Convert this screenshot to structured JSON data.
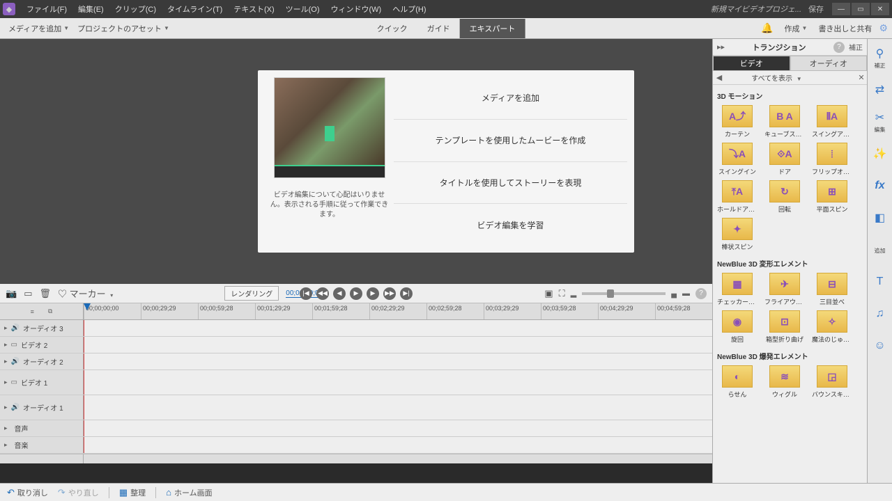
{
  "titlebar": {
    "menus": [
      "ファイル(F)",
      "編集(E)",
      "クリップ(C)",
      "タイムライン(T)",
      "テキスト(X)",
      "ツール(O)",
      "ウィンドウ(W)",
      "ヘルプ(H)"
    ],
    "project": "新規マイビデオプロジェ...",
    "save": "保存"
  },
  "toolbar": {
    "add_media": "メディアを追加",
    "project_assets": "プロジェクトのアセット",
    "modes": [
      "クイック",
      "ガイド",
      "エキスパート"
    ],
    "active_mode": 2,
    "create": "作成",
    "export": "書き出しと共有"
  },
  "welcome": {
    "desc": "ビデオ編集について心配はいりません。表示される手順に従って作業できます。",
    "items": [
      "メディアを追加",
      "テンプレートを使用したムービーを作成",
      "タイトルを使用してストーリーを表現",
      "ビデオ編集を学習"
    ]
  },
  "transitions": {
    "title": "トランジション",
    "tab_video": "ビデオ",
    "tab_audio": "オーディオ",
    "filter": "すべてを表示",
    "correction": "補正",
    "categories": [
      {
        "name": "3D モーション",
        "items": [
          "カーテン",
          "キューブスピン",
          "スイングアウト",
          "スイングイン",
          "ドア",
          "フリップオーバー",
          "ホールドアップ",
          "回転",
          "平面スピン",
          "棒状スピン"
        ]
      },
      {
        "name": "NewBlue 3D 変形エレメント",
        "items": [
          "チェッカーボード",
          "フライアウェイ",
          "三目並べ",
          "旋回",
          "箱型折り曲げ",
          "魔法のじゅうたん"
        ]
      },
      {
        "name": "NewBlue 3D 爆発エレメント",
        "items": [
          "らせん",
          "ウィグル",
          "バウンスキューブ"
        ]
      }
    ]
  },
  "side_tools": {
    "adjust": "補正",
    "transition": "",
    "scissors": "",
    "magic": "",
    "fx": "",
    "grad": "",
    "add": "追加",
    "text": "",
    "music": "",
    "smile": ""
  },
  "timeline": {
    "marker": "マーカー",
    "render": "レンダリング",
    "timecode": "00;00;00;00",
    "ruler": [
      "00;00;00;00",
      "00;00;29;29",
      "00;00;59;28",
      "00;01;29;29",
      "00;01;59;28",
      "00;02;29;29",
      "00;02;59;28",
      "00;03;29;29",
      "00;03;59;28",
      "00;04;29;29",
      "00;04;59;28"
    ],
    "tracks": [
      {
        "name": "オーディオ 3",
        "icon": "🔊",
        "tall": false
      },
      {
        "name": "ビデオ 2",
        "icon": "▭",
        "tall": false
      },
      {
        "name": "オーディオ 2",
        "icon": "🔊",
        "tall": false
      },
      {
        "name": "ビデオ 1",
        "icon": "▭",
        "tall": true
      },
      {
        "name": "オーディオ 1",
        "icon": "🔊",
        "tall": true
      },
      {
        "name": "音声",
        "icon": "",
        "tall": false
      },
      {
        "name": "音楽",
        "icon": "",
        "tall": false
      }
    ]
  },
  "bottom": {
    "undo": "取り消し",
    "redo": "やり直し",
    "organize": "整理",
    "home": "ホーム画面"
  }
}
